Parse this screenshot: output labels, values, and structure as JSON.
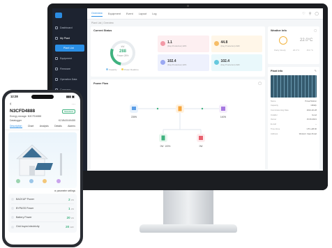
{
  "desktop": {
    "brand": {
      "line1": "",
      "line2": ""
    },
    "nav": [
      {
        "label": "Dashboard"
      },
      {
        "label": "My Plant"
      },
      {
        "label": "Equipment"
      },
      {
        "label": "Firmware"
      },
      {
        "label": "Operation Data"
      },
      {
        "label": "Company"
      }
    ],
    "nav_sub": "Plant List",
    "tabs": [
      "Overview",
      "Equipment",
      "Event",
      "Layout",
      "Log"
    ],
    "breadcrumb": "Plant List  |  Overview",
    "current_status": {
      "title": "Current Status",
      "donut_label": "kW",
      "donut_value": "288",
      "donut_sub": "Power 28%",
      "legend_a": "Capacity",
      "legend_b": "Power Realtime",
      "stats": [
        {
          "value": "1.1",
          "label": "(Day Production) kWh",
          "bg": "#fdeff1",
          "icon": "#f08a99"
        },
        {
          "value": "44.8",
          "label": "(Day Production) kWh",
          "bg": "#fff6e8",
          "icon": "#f5b350"
        },
        {
          "value": "102.4",
          "label": "(Day Production) kWh",
          "bg": "#eef1fd",
          "icon": "#8c9cf0"
        },
        {
          "value": "102.4",
          "label": "(Day Production) kWh",
          "bg": "#e9f8fb",
          "icon": "#4dc1d8"
        }
      ]
    },
    "power_flow": {
      "title": "Power Flow",
      "pv": "228W",
      "inverter": "",
      "load": "140W",
      "battery_w": "0W",
      "battery_pct": "100%",
      "grid": "0W"
    },
    "weather": {
      "title": "Weather Info",
      "temp": "22.0°C",
      "desc": "Partly Cloudy",
      "hi": "26.0 °C",
      "lo": "15.0 °C"
    },
    "plant": {
      "title": "Plant Info",
      "rows": [
        {
          "k": "Name",
          "v": "PowerStation"
        },
        {
          "k": "Capacity",
          "v": "10kWp"
        },
        {
          "k": "Commissioning Date",
          "v": "2024-02-28"
        },
        {
          "k": "Installer",
          "v": "Good"
        },
        {
          "k": "Owner",
          "v": "15-84-9021"
        },
        {
          "k": "E-mail",
          "v": "--"
        },
        {
          "k": "Time Zone",
          "v": "UTC+08:00"
        },
        {
          "k": "Address",
          "v": "Western Cape Road"
        }
      ]
    },
    "colors": {
      "accent": "#2a8fe6",
      "green": "#3fb27f",
      "sidebar": "#1d2330"
    }
  },
  "phone": {
    "time": "12:28",
    "signal": "▮▮▮ ▣",
    "device_id": "N3CFD4888",
    "badge": "Standard",
    "storage_label": "Energy storage:",
    "storage_id": "N3CFD4888",
    "datalogger_label": "Datalogger",
    "datalogger_id": "K21B43049455",
    "tabs": [
      "Description",
      "Chart",
      "Analysis",
      "Details",
      "Alarms"
    ],
    "settings": "parameter settings",
    "rows": [
      {
        "label": "BACKUP Power",
        "value": "2",
        "unit": "kW"
      },
      {
        "label": "BYPASS Power",
        "value": "1",
        "unit": "kW"
      },
      {
        "label": "Battery Power",
        "value": "20",
        "unit": "kW"
      },
      {
        "label": "Grid buyed electricity",
        "value": "20",
        "unit": "kWh"
      }
    ]
  }
}
